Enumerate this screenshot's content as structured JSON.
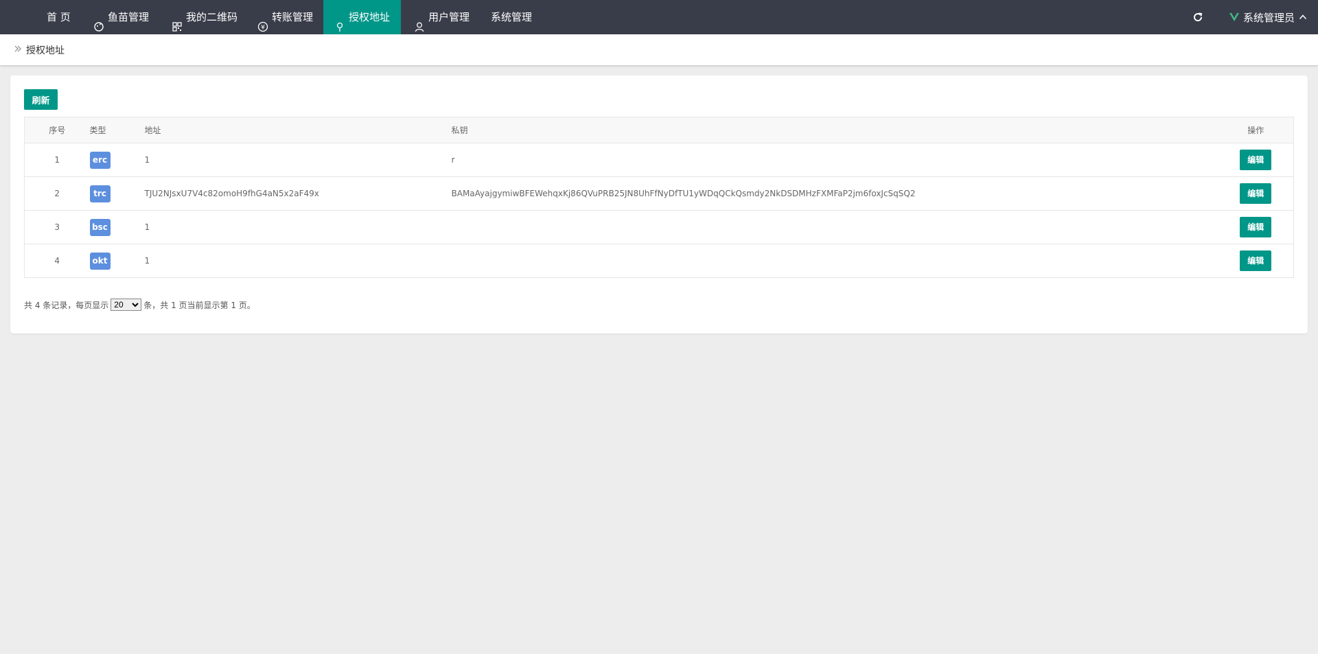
{
  "nav": {
    "items": [
      {
        "label": "首 页",
        "icon": "home-icon"
      },
      {
        "label": "鱼苗管理",
        "icon": "fish-icon"
      },
      {
        "label": "我的二维码",
        "icon": "qrcode-icon"
      },
      {
        "label": "转账管理",
        "icon": "yen-icon"
      },
      {
        "label": "授权地址",
        "icon": "location-pin-icon"
      },
      {
        "label": "用户管理",
        "icon": "user-icon"
      },
      {
        "label": "系统管理",
        "icon": ""
      }
    ],
    "active_label": "授权地址",
    "user_label": "系统管理员",
    "accent_color": "#009688",
    "bar_color": "#393d49"
  },
  "breadcrumb": {
    "label": "授权地址"
  },
  "toolbar": {
    "refresh_label": "刷新"
  },
  "table": {
    "headers": {
      "idx": "序号",
      "type": "类型",
      "addr": "地址",
      "key": "私钥",
      "op": "操作"
    },
    "rows": [
      {
        "idx": "1",
        "type": "erc",
        "addr": "1",
        "key": "r",
        "op": "编辑"
      },
      {
        "idx": "2",
        "type": "trc",
        "addr": "TJU2NJsxU7V4c82omoH9fhG4aN5x2aF49x",
        "key": "BAMaAyajgymiwBFEWehqxKj86QVuPRB25JN8UhFfNyDfTU1yWDqQCkQsmdy2NkDSDMHzFXMFaP2jm6foxJcSqSQ2",
        "op": "编辑"
      },
      {
        "idx": "3",
        "type": "bsc",
        "addr": "1",
        "key": "",
        "op": "编辑"
      },
      {
        "idx": "4",
        "type": "okt",
        "addr": "1",
        "key": "",
        "op": "编辑"
      }
    ],
    "tag_color": "#5d8fdf"
  },
  "pager": {
    "prefix": "共 4 条记录，每页显示",
    "page_size": "20",
    "suffix": "条，共 1 页当前显示第 1 页。"
  }
}
